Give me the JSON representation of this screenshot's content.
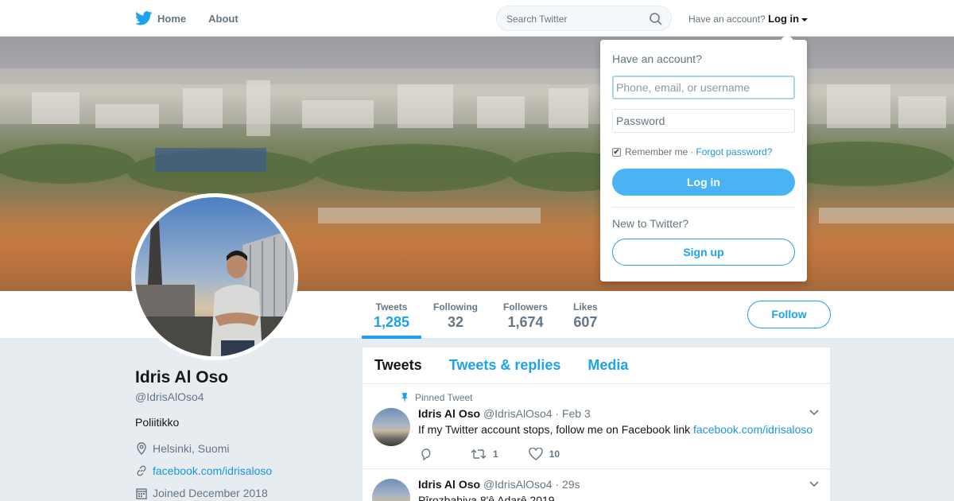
{
  "nav": {
    "home_label": "Home",
    "about_label": "About",
    "search_placeholder": "Search Twitter",
    "account_prompt": "Have an account?",
    "login_label": "Log in"
  },
  "profile": {
    "name": "Idris Al Oso",
    "handle": "@IdrisAlOso4",
    "bio": "Poliitikko",
    "location": "Helsinki, Suomi",
    "website": "facebook.com/idrisaloso",
    "joined": "Joined December 2018"
  },
  "stats": [
    {
      "label": "Tweets",
      "value": "1,285"
    },
    {
      "label": "Following",
      "value": "32"
    },
    {
      "label": "Followers",
      "value": "1,674"
    },
    {
      "label": "Likes",
      "value": "607"
    }
  ],
  "follow_label": "Follow",
  "tabs": [
    "Tweets",
    "Tweets & replies",
    "Media"
  ],
  "tweets": [
    {
      "pinned_label": "Pinned Tweet",
      "name": "Idris Al Oso",
      "handle": "@IdrisAlOso4",
      "time": "· Feb 3",
      "text": "If my Twitter account stops, follow me on Facebook link",
      "link": "facebook.com/idrisaloso",
      "retweets": "1",
      "likes": "10"
    },
    {
      "name": "Idris Al Oso",
      "handle": "@IdrisAlOso4",
      "time": "· 29s",
      "text": "Pîrozbahiya 8'ê Adarê 2019"
    }
  ],
  "login_dropdown": {
    "title": "Have an account?",
    "username_placeholder": "Phone, email, or username",
    "password_placeholder": "Password",
    "remember_label": "Remember me",
    "separator": "·",
    "forgot_label": "Forgot password?",
    "login_button": "Log in",
    "new_prompt": "New to Twitter?",
    "signup_button": "Sign up"
  },
  "colors": {
    "accent": "#1da1f2",
    "link": "#1b95e0",
    "login_button_bg": "#4ab3f4",
    "page_bg": "#e6ecf0"
  }
}
